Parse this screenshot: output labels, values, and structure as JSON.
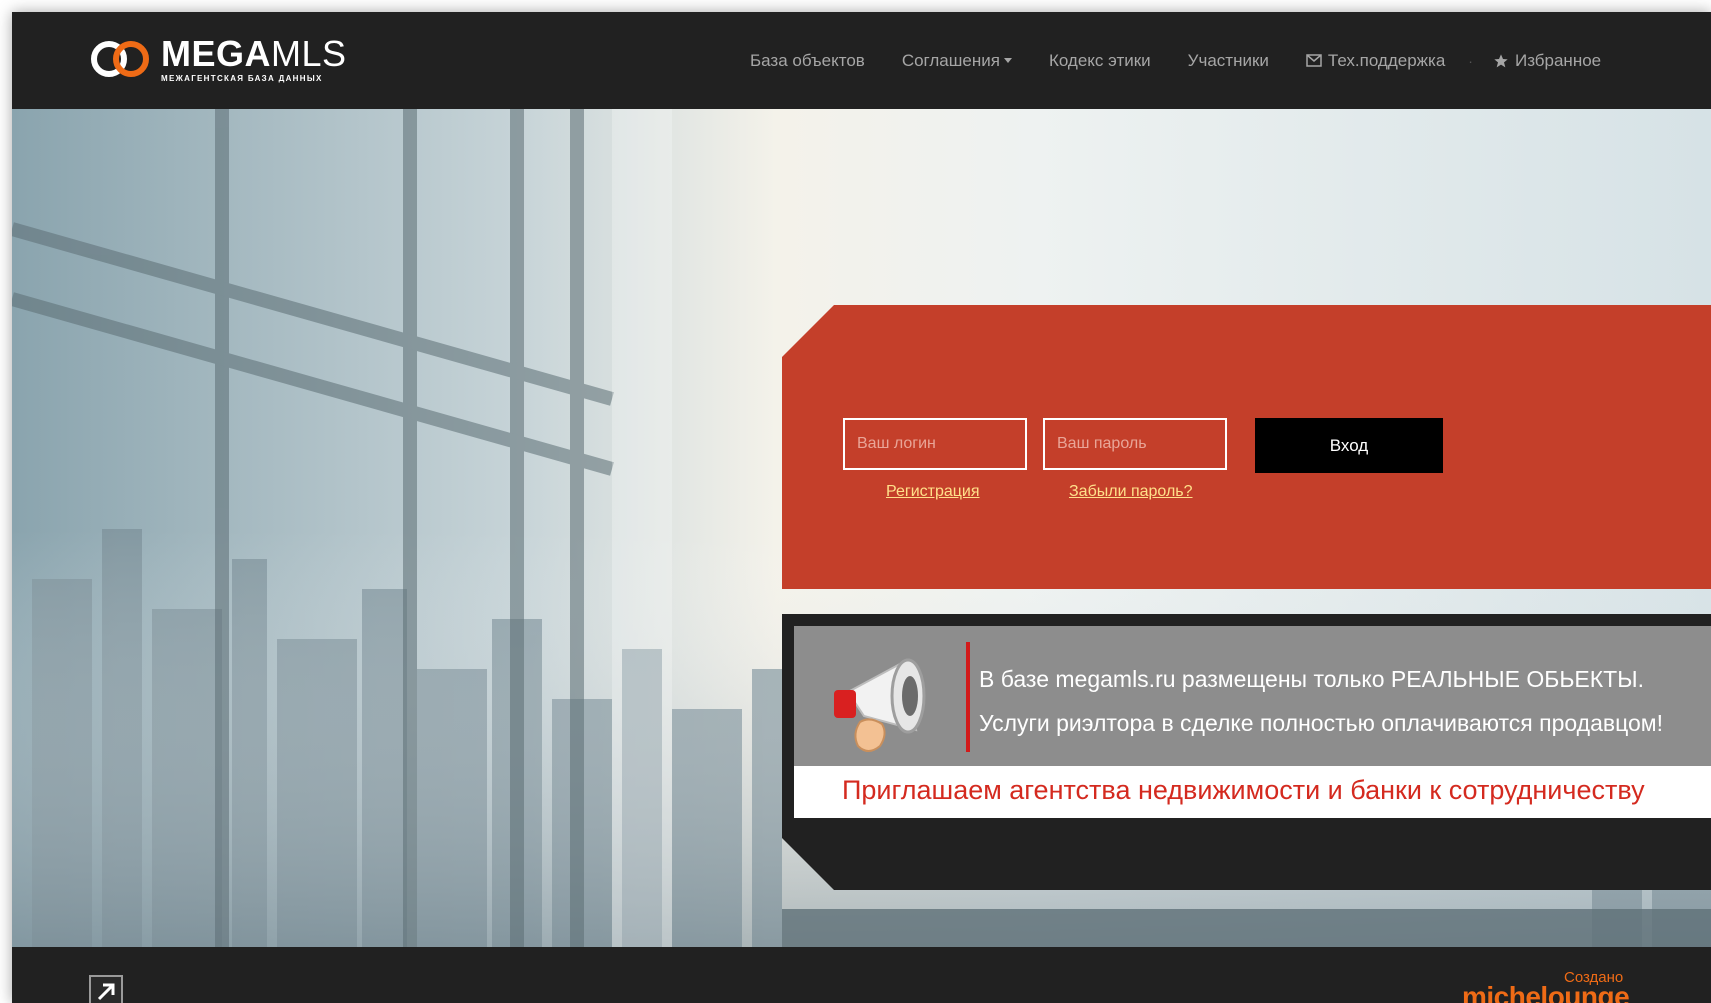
{
  "header": {
    "logo": {
      "title_bold": "MEGA",
      "title_light": "MLS",
      "subtitle": "МЕЖАГЕНТСКАЯ БАЗА ДАННЫХ"
    },
    "nav": {
      "objects": "База объектов",
      "agreements": "Соглашения",
      "ethics": "Кодекс этики",
      "members": "Участники",
      "support": "Тех.поддержка",
      "favorites": "Избранное"
    }
  },
  "login": {
    "login_placeholder": "Ваш логин",
    "password_placeholder": "Ваш пароль",
    "submit_label": "Вход",
    "register_link": "Регистрация",
    "forgot_link": "Забыли пароль?"
  },
  "info": {
    "line1": "В базе megamls.ru размещены только РЕАЛЬНЫЕ ОБЬЕКТЫ.",
    "line2": "Услуги риэлтора в сделке полностью оплачиваются продавцом!",
    "invite": "Приглашаем агентства недвижимости и банки к сотрудничеству"
  },
  "footer": {
    "created_label": "Создано",
    "brand": "michelounge"
  },
  "colors": {
    "header_bg": "#212121",
    "login_panel": "#c43f2a",
    "link": "#ffe08a",
    "brand_orange": "#ef6b16",
    "invite_red": "#d42a1f"
  },
  "icons": [
    "envelope-icon",
    "star-icon",
    "megaphone-icon",
    "expand-arrow-icon"
  ]
}
